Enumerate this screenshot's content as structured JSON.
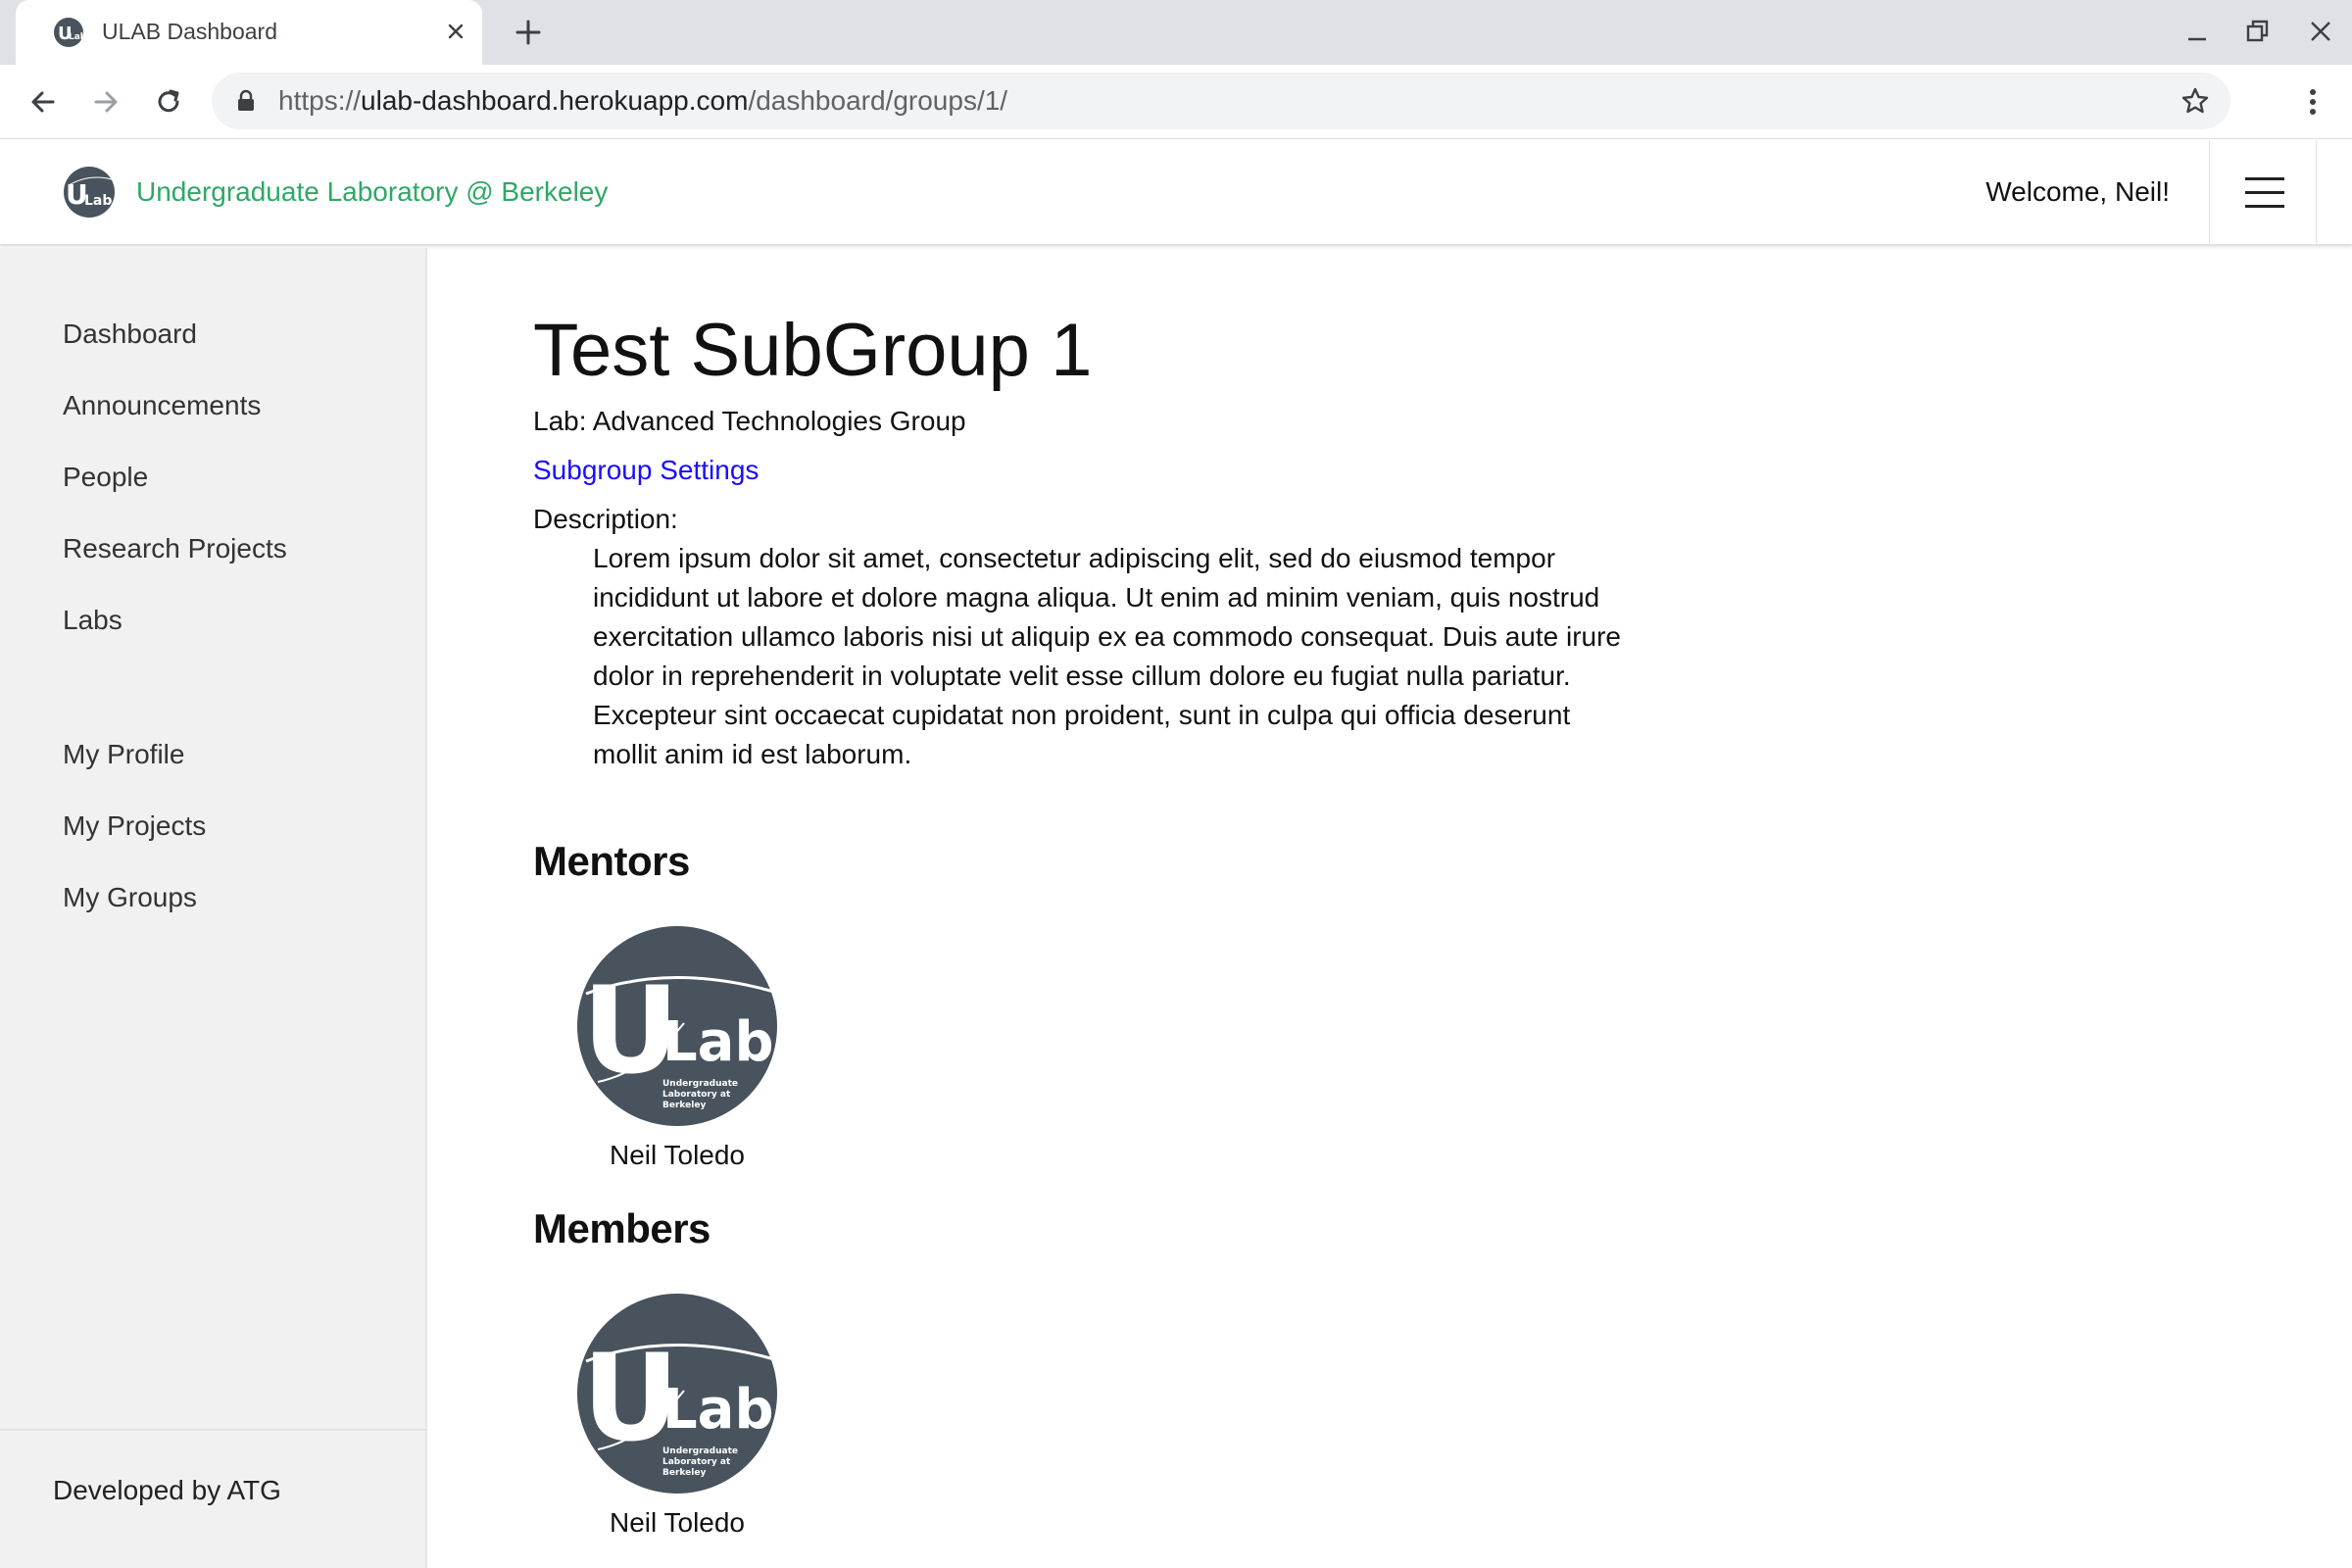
{
  "browser": {
    "tab_title": "ULAB Dashboard",
    "url_scheme": "https://",
    "url_host": "ulab-dashboard.herokuapp.com",
    "url_path": "/dashboard/groups/1/"
  },
  "header": {
    "brand_name": "Undergraduate Laboratory @ Berkeley",
    "welcome": "Welcome, Neil!"
  },
  "sidebar": {
    "primary_items": [
      {
        "label": "Dashboard"
      },
      {
        "label": "Announcements"
      },
      {
        "label": "People"
      },
      {
        "label": "Research Projects"
      },
      {
        "label": "Labs"
      }
    ],
    "personal_items": [
      {
        "label": "My Profile"
      },
      {
        "label": "My Projects"
      },
      {
        "label": "My Groups"
      }
    ],
    "footer": "Developed by ATG"
  },
  "main": {
    "title": "Test SubGroup 1",
    "lab_line": "Lab: Advanced Technologies Group",
    "settings_link": "Subgroup Settings",
    "description_label": "Description:",
    "description": "Lorem ipsum dolor sit amet, consectetur adipiscing elit, sed do eiusmod tempor incididunt ut labore et dolore magna aliqua. Ut enim ad minim veniam, quis nostrud exercitation ullamco laboris nisi ut aliquip ex ea commodo consequat. Duis aute irure dolor in reprehenderit in voluptate velit esse cillum dolore eu fugiat nulla pariatur. Excepteur sint occaecat cupidatat non proident, sunt in culpa qui officia deserunt mollit anim id est laborum.",
    "mentors_heading": "Mentors",
    "mentors": [
      {
        "name": "Neil Toledo"
      }
    ],
    "members_heading": "Members",
    "members": [
      {
        "name": "Neil Toledo"
      }
    ]
  },
  "logo": {
    "letter_u": "U",
    "word_lab": "Lab",
    "caption_1": "Undergraduate",
    "caption_2": "Laboratory at",
    "caption_3": "Berkeley"
  },
  "colors": {
    "brand_green": "#2ea866",
    "link_blue": "#1a0dff",
    "logo_slate": "#48535d",
    "sidebar_bg": "#f1f1f1"
  },
  "icons": {
    "back": "arrow-left-icon",
    "forward": "arrow-right-icon",
    "reload": "reload-icon",
    "lock": "lock-icon",
    "bookmark": "star-icon",
    "menu": "hamburger-icon"
  }
}
